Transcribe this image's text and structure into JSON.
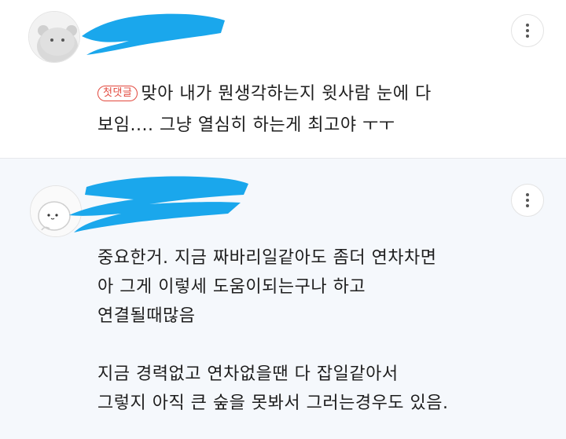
{
  "comments": [
    {
      "badge": "첫댓글",
      "lines": [
        "맞아 내가 뭔생각하는지 윗사람 눈에 다",
        "보임.... 그냥 열심히 하는게 최고야 ㅜㅜ"
      ],
      "more_icon": "more-vertical-icon"
    },
    {
      "lines": [
        "중요한거. 지금 짜바리일같아도 좀더 연차차면",
        "아 그게 이렇세 도움이되는구나 하고",
        "연결될때많음",
        "",
        "지금 경력없고 연차없을땐 다 잡일같아서",
        "그렇지 아직 큰 숲을 못봐서 그러는경우도 있음."
      ],
      "more_icon": "more-vertical-icon"
    }
  ],
  "colors": {
    "badge": "#e2483d",
    "redaction": "#1aa7ec",
    "highlight_background": "#f5f8fc"
  }
}
